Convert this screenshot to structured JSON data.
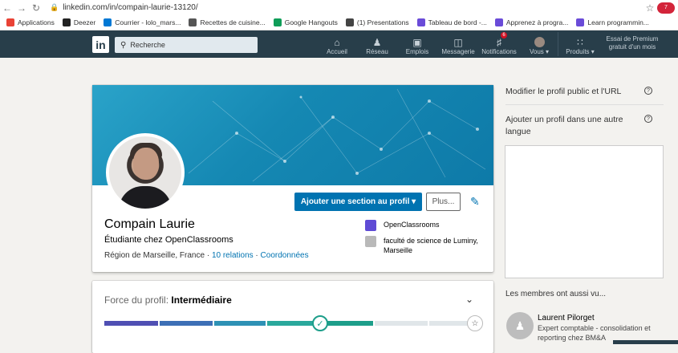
{
  "browser": {
    "url": "linkedin.com/in/compain-laurie-13120/",
    "ext_badge": "7"
  },
  "bookmarks": [
    {
      "label": "Applications",
      "color": "#e94235"
    },
    {
      "label": "Deezer",
      "color": "#222222"
    },
    {
      "label": "Courrier - lolo_mars...",
      "color": "#0078d4"
    },
    {
      "label": "Recettes de cuisine...",
      "color": "#555555"
    },
    {
      "label": "Google Hangouts",
      "color": "#0f9d58"
    },
    {
      "label": "(1) Presentations",
      "color": "#444444"
    },
    {
      "label": "Tableau de bord -...",
      "color": "#6a4bd8"
    },
    {
      "label": "Apprenez à progra...",
      "color": "#6a4bd8"
    },
    {
      "label": "Learn programmin...",
      "color": "#6a4bd8"
    }
  ],
  "nav": {
    "logo": "in",
    "search_placeholder": "Recherche",
    "items": [
      {
        "label": "Accueil",
        "icon": "home-icon"
      },
      {
        "label": "Réseau",
        "icon": "network-icon"
      },
      {
        "label": "Emplois",
        "icon": "briefcase-icon"
      },
      {
        "label": "Messagerie",
        "icon": "messaging-icon"
      },
      {
        "label": "Notifications",
        "icon": "bell-icon",
        "badge": "6"
      },
      {
        "label": "Vous ▾",
        "icon": "avatar"
      },
      {
        "label": "Produits ▾",
        "icon": "grid-icon"
      }
    ],
    "premium": "Essai de Premium gratuit d'un mois"
  },
  "profile": {
    "add_section_label": "Ajouter une section au profil ▾",
    "more_label": "Plus...",
    "name": "Compain Laurie",
    "headline": "Étudiante chez OpenClassrooms",
    "location": "Région de Marseille, France",
    "separator": " · ",
    "relations": "10 relations",
    "contact": "Coordonnées",
    "experience": [
      {
        "line1": "OpenClassrooms",
        "line2": "",
        "color": "#5f4bd5"
      },
      {
        "line1": "faculté de science de Luminy,",
        "line2": "Marseille",
        "color": "#b9b9b9"
      }
    ]
  },
  "strength": {
    "label": "Force du profil: ",
    "level": "Intermédiaire",
    "segment_colors": [
      "#4f4fb3",
      "#3d6fb6",
      "#2d91b5",
      "#2aa89c",
      "#1d9e8a",
      "#e0e6e9",
      "#e0e6e9"
    ]
  },
  "sidebar": {
    "edit_public": "Modifier le profil public et l'URL",
    "add_language": "Ajouter un profil dans une autre langue",
    "also_viewed": "Les membres ont aussi vu...",
    "member": {
      "name": "Laurent Pilorget",
      "title": "Expert comptable - consolidation et reporting chez BM&A"
    }
  }
}
